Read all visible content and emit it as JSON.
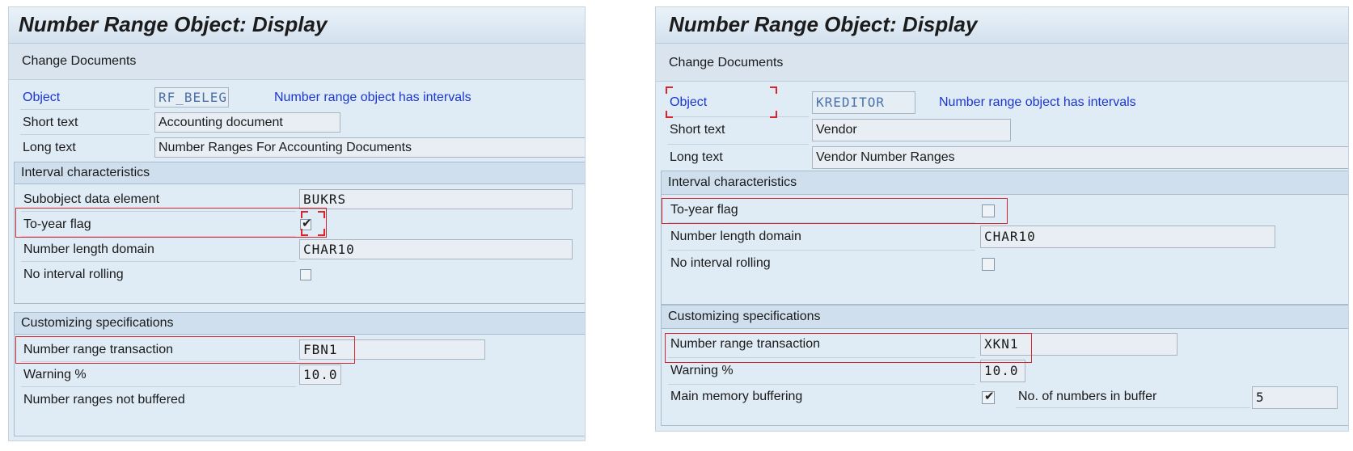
{
  "left": {
    "title": "Number Range Object: Display",
    "toolbar_button": "Change Documents",
    "object_label": "Object",
    "object_value": "RF_BELEG",
    "intervals_note": "Number range object has intervals",
    "short_text_label": "Short text",
    "short_text_value": "Accounting document",
    "long_text_label": "Long text",
    "long_text_value": "Number Ranges For Accounting Documents",
    "interval_group": "Interval characteristics",
    "subobject_label": "Subobject data element",
    "subobject_value": "BUKRS",
    "to_year_label": "To-year flag",
    "to_year_checked": true,
    "number_length_label": "Number length domain",
    "number_length_value": "CHAR10",
    "no_rolling_label": "No interval rolling",
    "no_rolling_checked": false,
    "custom_group": "Customizing specifications",
    "transaction_label": "Number range transaction",
    "transaction_value": "FBN1",
    "warning_label": "Warning %",
    "warning_value": "10.0",
    "buffer_label": "Number ranges not buffered"
  },
  "right": {
    "title": "Number Range Object: Display",
    "toolbar_button": "Change Documents",
    "object_label": "Object",
    "object_value": "KREDITOR",
    "intervals_note": "Number range object has intervals",
    "short_text_label": "Short text",
    "short_text_value": "Vendor",
    "long_text_label": "Long text",
    "long_text_value": "Vendor Number Ranges",
    "interval_group": "Interval characteristics",
    "to_year_label": "To-year flag",
    "to_year_checked": false,
    "number_length_label": "Number length domain",
    "number_length_value": "CHAR10",
    "no_rolling_label": "No interval rolling",
    "no_rolling_checked": false,
    "custom_group": "Customizing specifications",
    "transaction_label": "Number range transaction",
    "transaction_value": "XKN1",
    "warning_label": "Warning %",
    "warning_value": "10.0",
    "buffer_label": "Main memory buffering",
    "buffer_checked": true,
    "buffer_count_label": "No. of numbers in buffer",
    "buffer_count_value": "5"
  },
  "icons": {
    "checkmark": "✔"
  },
  "colors": {
    "highlight": "#d8252b",
    "link_blue": "#1a37d0",
    "panel_bg": "#dfebf5"
  }
}
